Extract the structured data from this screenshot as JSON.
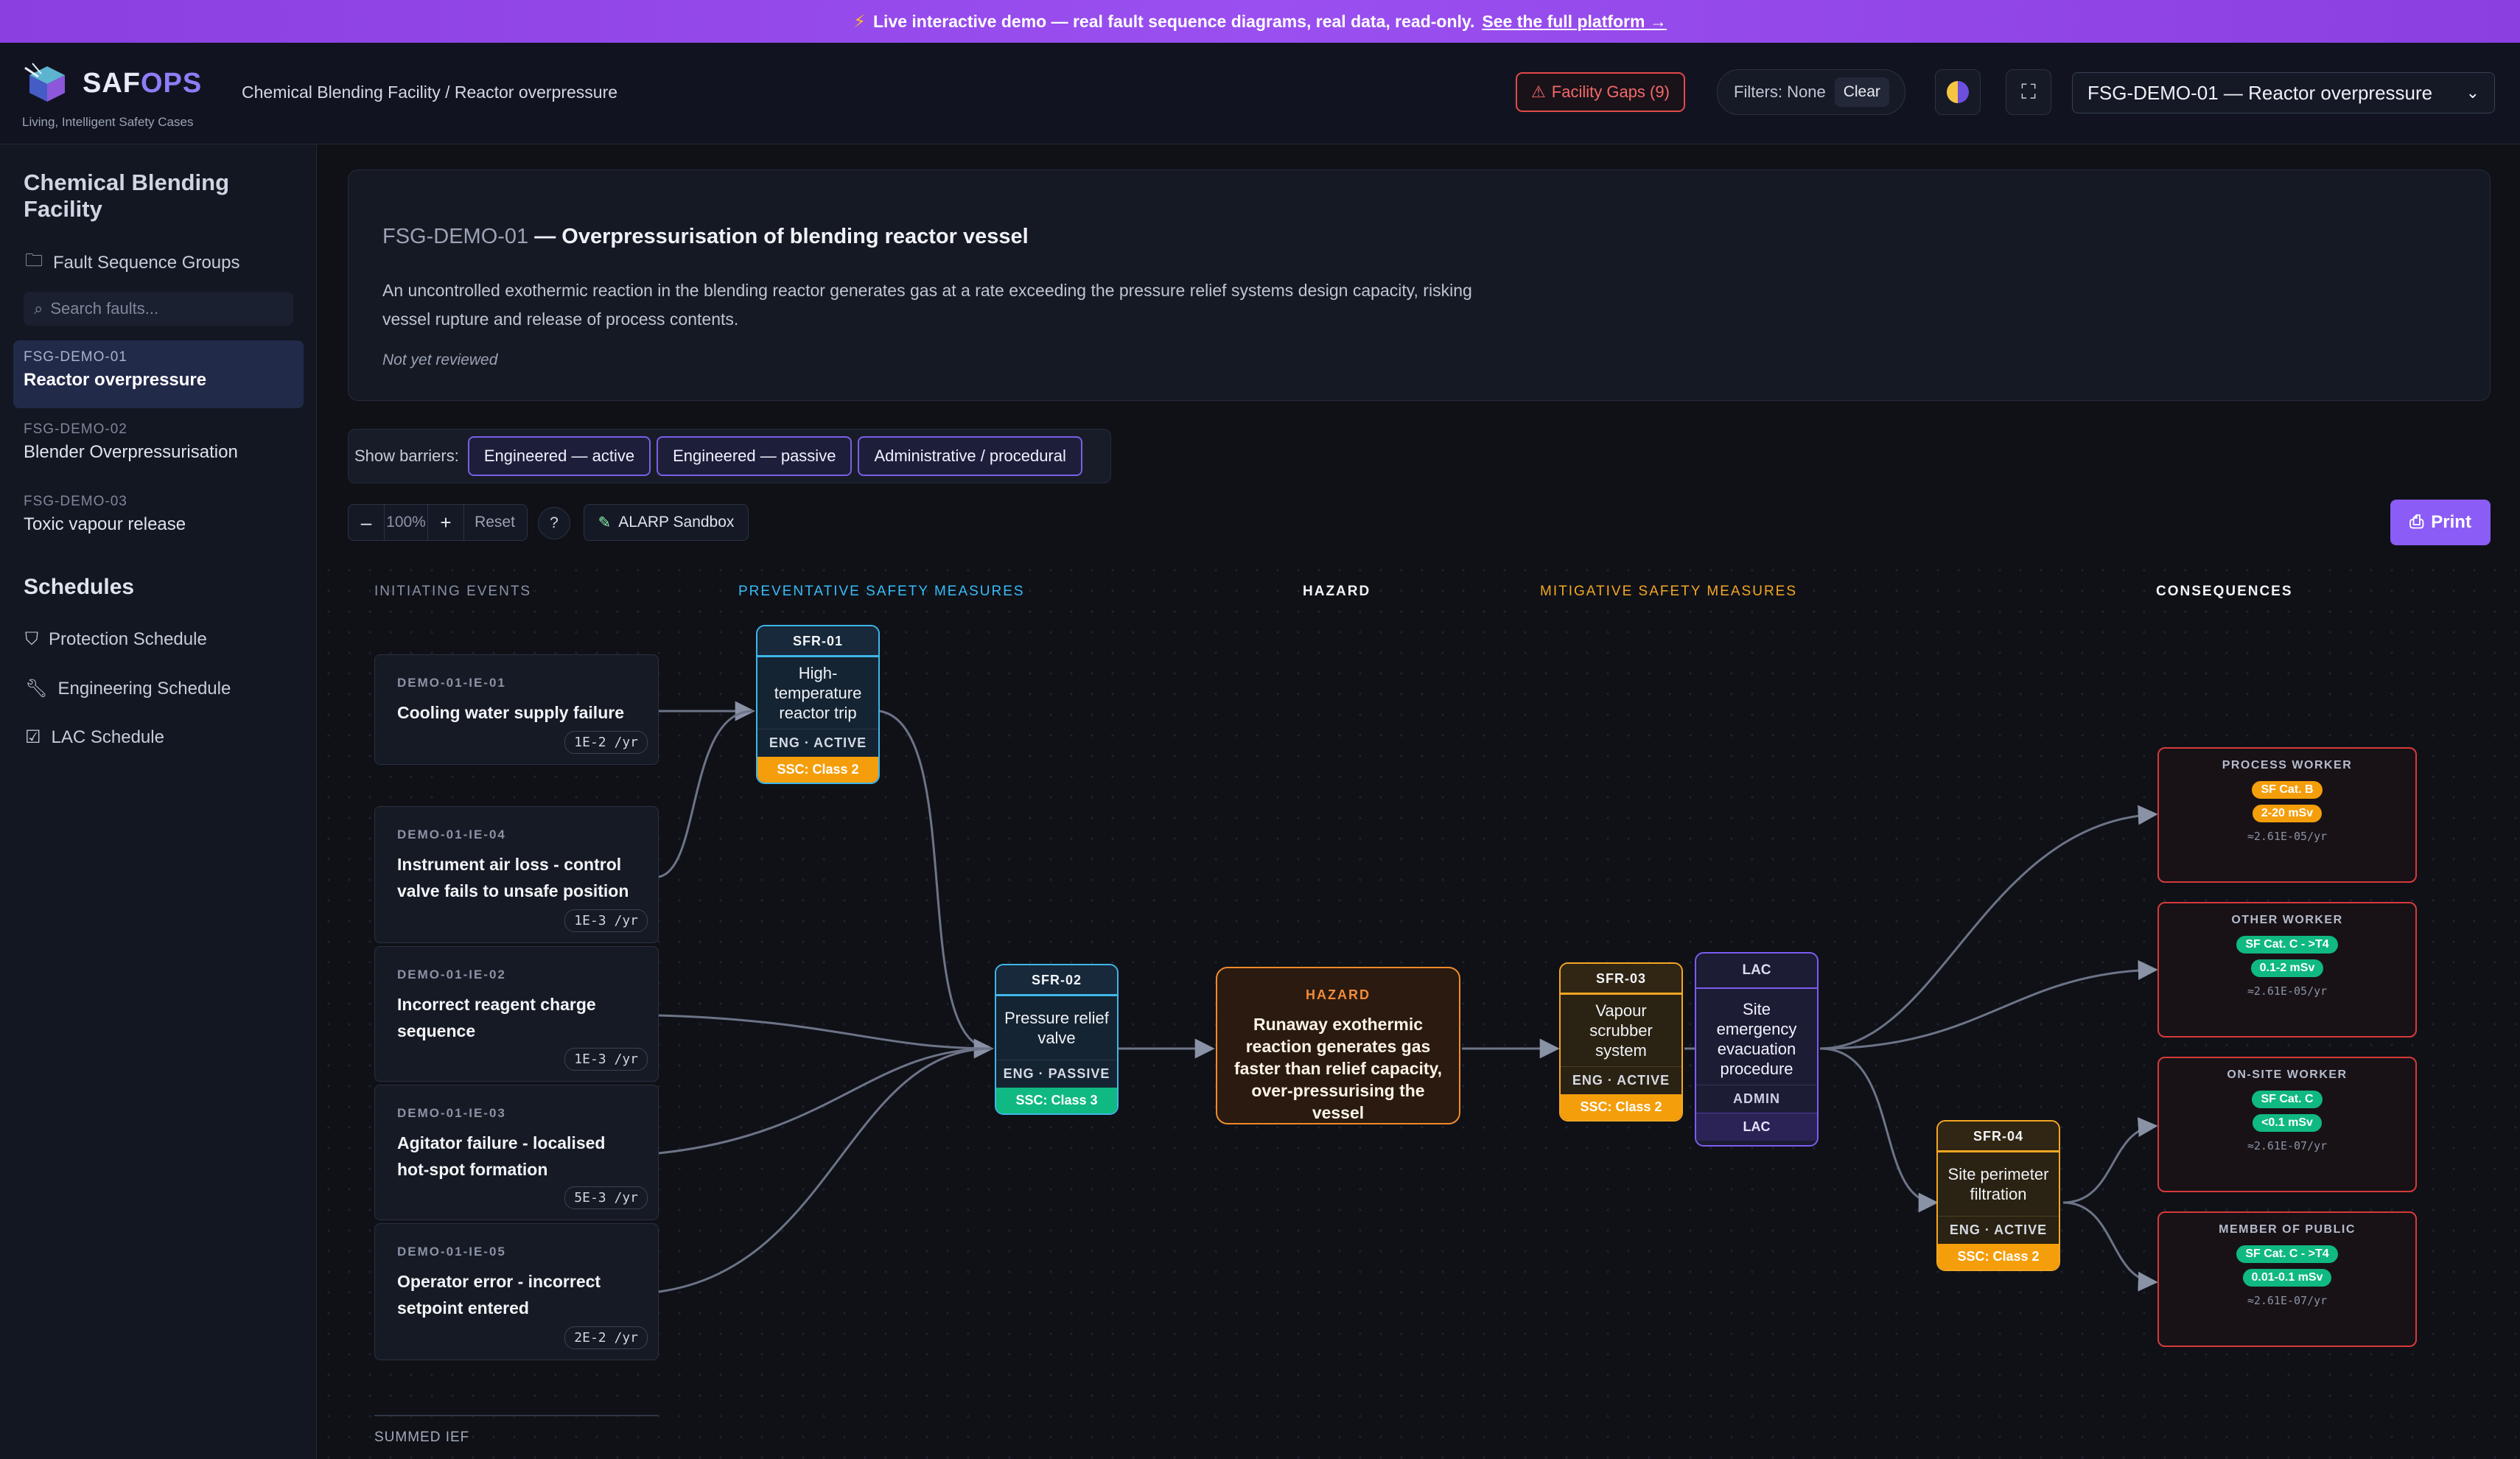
{
  "banner": {
    "text": "Live interactive demo — real fault sequence diagrams, real data, read-only.",
    "link": "See the full platform →"
  },
  "header": {
    "brand_saf": "SAF",
    "brand_ops": "OPS",
    "tagline": "Living, Intelligent Safety Cases",
    "breadcrumb": "Chemical Blending Facility / Reactor overpressure",
    "gaps_label": "Facility Gaps (9)",
    "filters_label": "Filters: None",
    "clear_label": "Clear",
    "fsg_select_value": "FSG-DEMO-01 — Reactor overpressure"
  },
  "sidebar": {
    "facility": "Chemical Blending Facility",
    "fsg_link": "Fault Sequence Groups",
    "search_placeholder": "Search faults...",
    "faults": [
      {
        "id": "FSG-DEMO-01",
        "name": "Reactor overpressure"
      },
      {
        "id": "FSG-DEMO-02",
        "name": "Blender Overpressurisation"
      },
      {
        "id": "FSG-DEMO-03",
        "name": "Toxic vapour release"
      }
    ],
    "schedules_heading": "Schedules",
    "schedules": [
      "Protection Schedule",
      "Engineering Schedule",
      "LAC Schedule"
    ]
  },
  "summary": {
    "fsg": "FSG-DEMO-01",
    "title": " — Overpressurisation of blending reactor vessel",
    "description": "An uncontrolled exothermic reaction in the blending reactor generates gas at a rate exceeding the pressure relief systems design capacity, risking vessel rupture and release of process contents.",
    "status": "Not yet reviewed"
  },
  "barriers": {
    "label": "Show barriers:",
    "chips": [
      "Engineered — active",
      "Engineered — passive",
      "Administrative / procedural"
    ]
  },
  "toolbar": {
    "minus": "–",
    "zoom": "100%",
    "plus": "+",
    "reset": "Reset",
    "help": "?",
    "alarp": "ALARP Sandbox",
    "print": "Print"
  },
  "diagram": {
    "columns": {
      "initiating": "INITIATING EVENTS",
      "preventative": "PREVENTATIVE SAFETY MEASURES",
      "hazard": "HAZARD",
      "mitigative": "MITIGATIVE SAFETY MEASURES",
      "consequences": "CONSEQUENCES"
    },
    "initiating_events": [
      {
        "code": "DEMO-01-IE-01",
        "name": "Cooling water supply failure",
        "freq": "1E-2 /yr"
      },
      {
        "code": "DEMO-01-IE-04",
        "name": "Instrument air loss - control valve fails to unsafe position",
        "freq": "1E-3 /yr"
      },
      {
        "code": "DEMO-01-IE-02",
        "name": "Incorrect reagent charge sequence",
        "freq": "1E-3 /yr"
      },
      {
        "code": "DEMO-01-IE-03",
        "name": "Agitator failure - localised hot-spot formation",
        "freq": "5E-3 /yr"
      },
      {
        "code": "DEMO-01-IE-05",
        "name": "Operator error - incorrect setpoint entered",
        "freq": "2E-2 /yr"
      }
    ],
    "sfr01": {
      "id": "SFR-01",
      "name": "High-temperature reactor trip",
      "type": "ENG · ACTIVE",
      "class": "SSC: Class 2"
    },
    "sfr02": {
      "id": "SFR-02",
      "name": "Pressure relief valve",
      "type": "ENG · PASSIVE",
      "class": "SSC: Class 3"
    },
    "hazard": {
      "label": "HAZARD",
      "text": "Runaway exothermic reaction generates gas faster than relief capacity, over-pressurising the vessel"
    },
    "sfr03": {
      "id": "SFR-03",
      "name": "Vapour scrubber system",
      "type": "ENG · ACTIVE",
      "class": "SSC: Class 2"
    },
    "lac": {
      "head": "LAC",
      "name": "Site emergency evacuation procedure",
      "type": "ADMIN",
      "foot": "LAC"
    },
    "sfr04": {
      "id": "SFR-04",
      "name": "Site perimeter filtration",
      "type": "ENG · ACTIVE",
      "class": "SSC: Class 2"
    },
    "consequences": [
      {
        "who": "PROCESS WORKER",
        "cat": "SF Cat. B",
        "dose": "2-20 mSv",
        "freq": "≈2.61E-05/yr"
      },
      {
        "who": "OTHER WORKER",
        "cat": "SF Cat. C - >T4",
        "dose": "0.1-2 mSv",
        "freq": "≈2.61E-05/yr"
      },
      {
        "who": "ON-SITE WORKER",
        "cat": "SF Cat. C",
        "dose": "<0.1 mSv",
        "freq": "≈2.61E-07/yr"
      },
      {
        "who": "MEMBER OF PUBLIC",
        "cat": "SF Cat. C - >T4",
        "dose": "0.01-0.1 mSv",
        "freq": "≈2.61E-07/yr"
      }
    ],
    "summed_label": "SUMMED IEF"
  },
  "colors": {
    "accent": "#8b5cf6",
    "preventative": "#38bdf8",
    "mitigative": "#f5a623",
    "hazard": "#f08a2a",
    "consequence": "#d63a3a",
    "ssc_orange": "#f59e0b",
    "ssc_green": "#10b981"
  }
}
